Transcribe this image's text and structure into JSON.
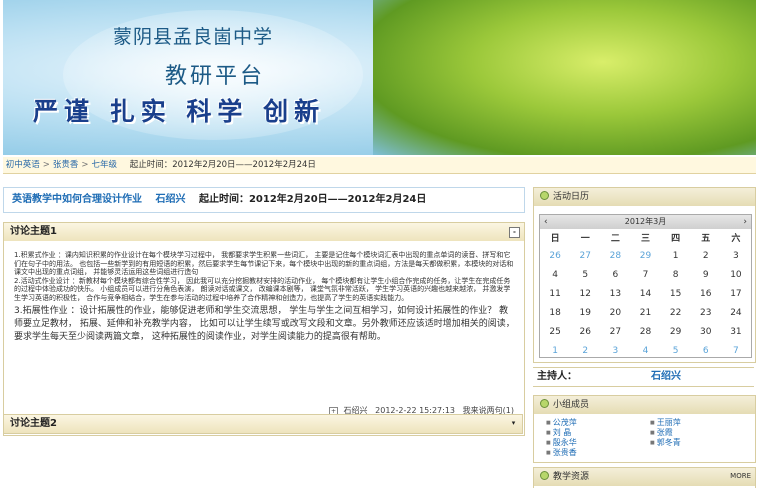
{
  "banner": {
    "school": "蒙阴县孟良崮中学",
    "platform": "教研平台",
    "motto": "严谨 扎实 科学 创新"
  },
  "breadcrumb": {
    "items": [
      "初中英语",
      "张贵香",
      "七年级"
    ],
    "time_label": "起止时间：2012年2月20日——2012年2月24日"
  },
  "activity": {
    "title": "英语教学中如何合理设计作业",
    "author": "石绍兴",
    "period": "起止时间：2012年2月20日——2012年2月24日"
  },
  "topic1": {
    "heading": "讨论主题1",
    "toggle": "-",
    "para1": "1.积累式作业 ：课内知识积累的作业设计在每个模块学习过程中， 我都要求学生积累一些词汇， 主要是记住每个模块词汇表中出现的重点单词的读音、拼写和它们在句子中的用法。 也包括一些新学到的有用短语的积累，然后要求学生每节课记下来，每个模块中出现的新的重点词组，方法是每天都做积累，本模块的对话和课文中出现的重点词组， 并能够灵活运用这些词组进行造句",
    "para2": "2.活动式作业设计 ：新教材每个模块都有综合性学习， 因此我可以充分挖掘教材安排的活动作业， 每个模块都有让学生小组合作完成的任务，让学生在完成任务的过程中体验成功的快乐。 小组成员可以进行分角色表演， 朗读对话或课文， 改编课本剧等， 课堂气氛非常活跃， 学生学习英语的兴趣也越来越浓， 并激发学生学习英语的积极性， 合作与竞争相结合，学生在参与活动的过程中培养了合作精神和创造力，也提高了学生的英语实践能力。",
    "para3": "3.拓展性作业 ：设计拓展性的作业，能够促进老师和学生交流思想， 学生与学生之间互相学习，如何设计拓展性的作业？ 教师要立足教材， 拓展、延伸和补充教学内容， 比如可以让学生续写或改写文段和文章。另外教师还应该适时增加相关的阅读， 要求学生每天至少阅读两篇文章， 这种拓展性的阅读作业，对学生阅读能力的提高很有帮助。",
    "meta_author": "石绍兴",
    "meta_time": "2012-2-22 15:27:13",
    "meta_reply": "我来说两句(1)"
  },
  "topic2": {
    "heading": "讨论主题2"
  },
  "calendar": {
    "heading": "活动日历",
    "month": "2012年3月",
    "prev": "‹",
    "next": "›",
    "weekdays": [
      "日",
      "一",
      "二",
      "三",
      "四",
      "五",
      "六"
    ],
    "rows": [
      [
        "26",
        "27",
        "28",
        "29",
        "1",
        "2",
        "3"
      ],
      [
        "4",
        "5",
        "6",
        "7",
        "8",
        "9",
        "10"
      ],
      [
        "11",
        "12",
        "13",
        "14",
        "15",
        "16",
        "17"
      ],
      [
        "18",
        "19",
        "20",
        "21",
        "22",
        "23",
        "24"
      ],
      [
        "25",
        "26",
        "27",
        "28",
        "29",
        "30",
        "31"
      ],
      [
        "1",
        "2",
        "3",
        "4",
        "5",
        "6",
        "7"
      ]
    ],
    "other_month_color": "#5aa3d8"
  },
  "host": {
    "label": "主持人：",
    "name": "石绍兴"
  },
  "members": {
    "heading": "小组成员",
    "col1": [
      "公茂萍",
      "刘 晶",
      "殷永华",
      "张贵香"
    ],
    "col2": [
      "王丽萍",
      "张霞",
      "郭冬青"
    ]
  },
  "resources": {
    "heading": "教学资源",
    "more": "MORE"
  },
  "colors": {
    "link": "#1f6db5",
    "panel_border": "#d8cda0",
    "crumb_bg": "#fff8df"
  }
}
